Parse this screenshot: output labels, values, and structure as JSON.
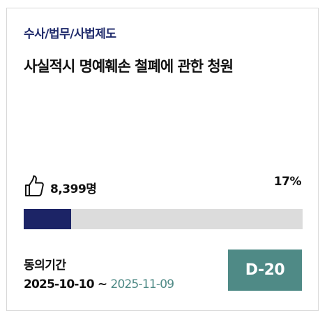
{
  "petition": {
    "category": "수사/법무/사법제도",
    "title": "사실적시 명예훼손 철폐에 관한 청원",
    "likes": {
      "icon": "thumbs-up-icon",
      "count_label": "8,399명"
    },
    "progress": {
      "label": "17%",
      "value_percent": 17
    },
    "period": {
      "label": "동의기간",
      "start": "2025-10-10",
      "separator": " ~ ",
      "end": "2025-11-09"
    },
    "dday": "D-20"
  },
  "colors": {
    "category": "#1f2a6b",
    "progress_fill": "#1c2466",
    "progress_track": "#dcdcdc",
    "end_date": "#4f8a86",
    "dday_background": "#4f8a86"
  }
}
